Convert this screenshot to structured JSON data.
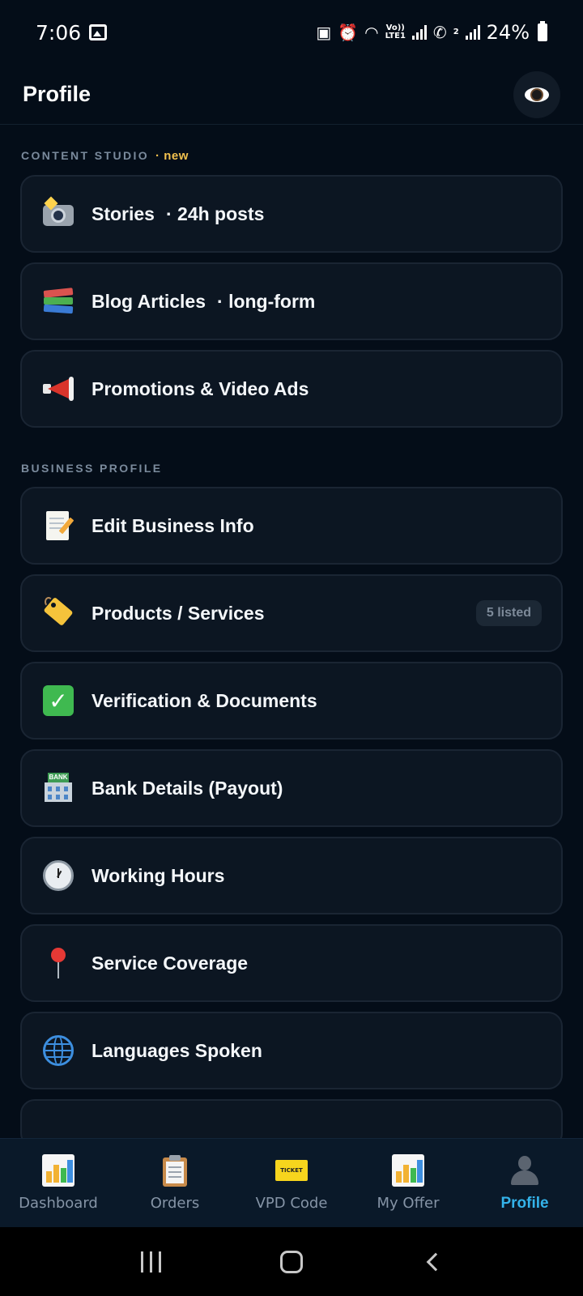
{
  "status_bar": {
    "time": "7:06",
    "network_tag_top": "Vo))",
    "network_tag_bottom": "LTE1",
    "sim2": "2",
    "battery": "24%"
  },
  "header": {
    "title": "Profile"
  },
  "content_studio": {
    "label": "CONTENT STUDIO",
    "new_tag": "· new",
    "items": [
      {
        "label": "Stories",
        "sub": "· 24h posts",
        "icon": "camera-flash-icon"
      },
      {
        "label": "Blog Articles",
        "sub": "· long-form",
        "icon": "books-icon"
      },
      {
        "label": "Promotions & Video Ads",
        "sub": "",
        "icon": "megaphone-icon"
      }
    ]
  },
  "business_profile": {
    "label": "BUSINESS PROFILE",
    "items": [
      {
        "label": "Edit Business Info",
        "icon": "memo-icon"
      },
      {
        "label": "Products / Services",
        "badge": "5 listed",
        "icon": "label-tag-icon"
      },
      {
        "label": "Verification & Documents",
        "icon": "check-mark-icon"
      },
      {
        "label": "Bank Details (Payout)",
        "icon": "bank-icon",
        "bank_sign": "BANK"
      },
      {
        "label": "Working Hours",
        "icon": "clock-icon"
      },
      {
        "label": "Service Coverage",
        "icon": "round-pin-icon"
      },
      {
        "label": "Languages Spoken",
        "icon": "globe-icon"
      }
    ]
  },
  "bottom_nav": {
    "items": [
      {
        "label": "Dashboard",
        "icon": "bar-chart-icon",
        "active": false
      },
      {
        "label": "Orders",
        "icon": "clipboard-icon",
        "active": false
      },
      {
        "label": "VPD Code",
        "icon": "ticket-icon",
        "ticket_text": "TICKET",
        "active": false
      },
      {
        "label": "My Offer",
        "icon": "bar-chart-icon",
        "active": false
      },
      {
        "label": "Profile",
        "icon": "user-silhouette-icon",
        "active": true
      }
    ]
  },
  "colors": {
    "background": "#040d18",
    "card": "#0c1622",
    "accent": "#34b3ea",
    "new_tag": "#f2c14e"
  }
}
